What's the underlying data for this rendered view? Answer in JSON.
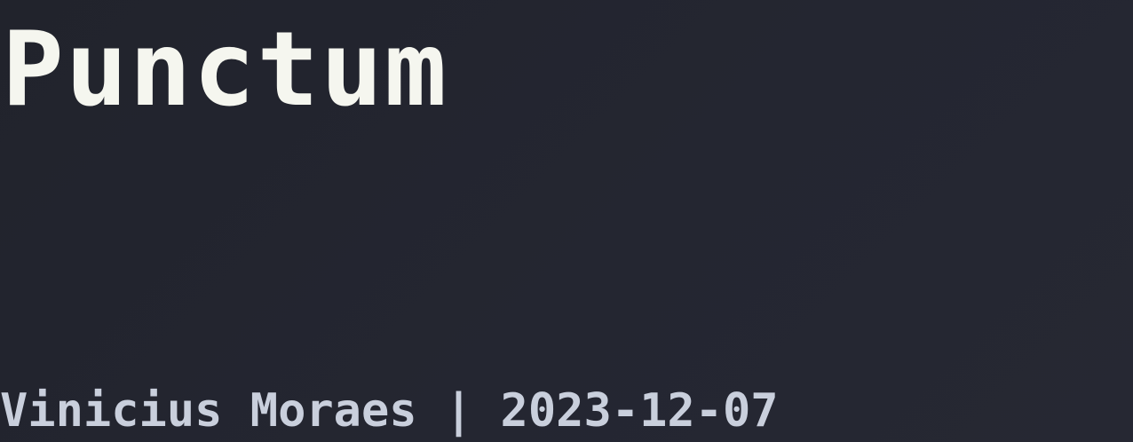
{
  "post": {
    "title": "Punctum",
    "author": "Vinicius Moraes",
    "separator": "|",
    "date": "2023-12-07"
  },
  "colors": {
    "background": "#23252f",
    "title": "#f5f6ef",
    "meta": "#c9cfdc"
  }
}
